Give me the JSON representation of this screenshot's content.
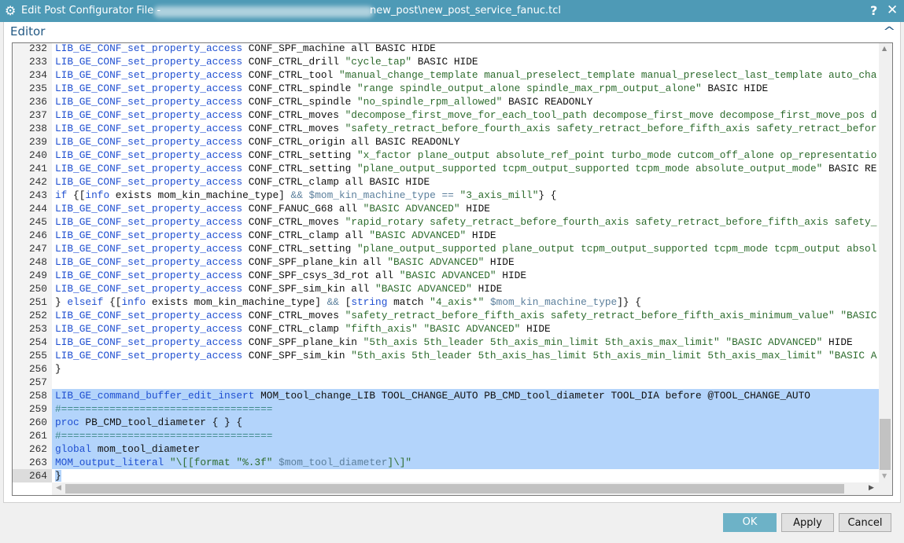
{
  "window": {
    "title": "Edit Post Configurator File -",
    "path": "new_post\\new_post_service_fanuc.tcl",
    "help": "?",
    "close": "✕",
    "icon": "gear-icon"
  },
  "section": {
    "label": "Editor",
    "collapse": "^"
  },
  "editor": {
    "current_line": 264,
    "selection": [
      258,
      264
    ],
    "lines": [
      {
        "n": 232,
        "seg": [
          [
            "c",
            "LIB_GE_CONF_set_property_access"
          ],
          [
            "p",
            " CONF_SPF_machine all BASIC HIDE"
          ]
        ]
      },
      {
        "n": 233,
        "seg": [
          [
            "c",
            "LIB_GE_CONF_set_property_access"
          ],
          [
            "p",
            " CONF_CTRL_drill "
          ],
          [
            "s",
            "\"cycle_tap\""
          ],
          [
            "p",
            " BASIC HIDE"
          ]
        ]
      },
      {
        "n": 234,
        "seg": [
          [
            "c",
            "LIB_GE_CONF_set_property_access"
          ],
          [
            "p",
            " CONF_CTRL_tool "
          ],
          [
            "s",
            "\"manual_change_template manual_preselect_template manual_preselect_last_template auto_cha"
          ]
        ]
      },
      {
        "n": 235,
        "seg": [
          [
            "c",
            "LIB_GE_CONF_set_property_access"
          ],
          [
            "p",
            " CONF_CTRL_spindle "
          ],
          [
            "s",
            "\"range spindle_output_alone spindle_max_rpm_output_alone\""
          ],
          [
            "p",
            " BASIC HIDE"
          ]
        ]
      },
      {
        "n": 236,
        "seg": [
          [
            "c",
            "LIB_GE_CONF_set_property_access"
          ],
          [
            "p",
            " CONF_CTRL_spindle "
          ],
          [
            "s",
            "\"no_spindle_rpm_allowed\""
          ],
          [
            "p",
            " BASIC READONLY"
          ]
        ]
      },
      {
        "n": 237,
        "seg": [
          [
            "c",
            "LIB_GE_CONF_set_property_access"
          ],
          [
            "p",
            " CONF_CTRL_moves "
          ],
          [
            "s",
            "\"decompose_first_move_for_each_tool_path decompose_first_move decompose_first_move_pos d"
          ]
        ]
      },
      {
        "n": 238,
        "seg": [
          [
            "c",
            "LIB_GE_CONF_set_property_access"
          ],
          [
            "p",
            " CONF_CTRL_moves "
          ],
          [
            "s",
            "\"safety_retract_before_fourth_axis safety_retract_before_fifth_axis safety_retract_befor"
          ]
        ]
      },
      {
        "n": 239,
        "seg": [
          [
            "c",
            "LIB_GE_CONF_set_property_access"
          ],
          [
            "p",
            " CONF_CTRL_origin all BASIC READONLY"
          ]
        ]
      },
      {
        "n": 240,
        "seg": [
          [
            "c",
            "LIB_GE_CONF_set_property_access"
          ],
          [
            "p",
            " CONF_CTRL_setting "
          ],
          [
            "s",
            "\"x_factor plane_output absolute_ref_point turbo_mode cutcom_off_alone op_representatio"
          ]
        ]
      },
      {
        "n": 241,
        "seg": [
          [
            "c",
            "LIB_GE_CONF_set_property_access"
          ],
          [
            "p",
            " CONF_CTRL_setting "
          ],
          [
            "s",
            "\"plane_output_supported tcpm_output_supported tcpm_mode absolute_output_mode\""
          ],
          [
            "p",
            " BASIC RE"
          ]
        ]
      },
      {
        "n": 242,
        "seg": [
          [
            "c",
            "LIB_GE_CONF_set_property_access"
          ],
          [
            "p",
            " CONF_CTRL_clamp all BASIC HIDE"
          ]
        ]
      },
      {
        "n": 243,
        "seg": [
          [
            "k",
            "if"
          ],
          [
            "p",
            " {["
          ],
          [
            "k",
            "info"
          ],
          [
            "p",
            " exists mom_kin_machine_type] "
          ],
          [
            "v",
            "&& $mom_kin_machine_type =="
          ],
          [
            "p",
            " "
          ],
          [
            "s",
            "\"3_axis_mill\""
          ],
          [
            "p",
            "} {"
          ]
        ]
      },
      {
        "n": 244,
        "seg": [
          [
            "c",
            "LIB_GE_CONF_set_property_access"
          ],
          [
            "p",
            " CONF_FANUC_G68 all "
          ],
          [
            "s",
            "\"BASIC ADVANCED\""
          ],
          [
            "p",
            " HIDE"
          ]
        ]
      },
      {
        "n": 245,
        "seg": [
          [
            "c",
            "LIB_GE_CONF_set_property_access"
          ],
          [
            "p",
            " CONF_CTRL_moves "
          ],
          [
            "s",
            "\"rapid_rotary safety_retract_before_fourth_axis safety_retract_before_fifth_axis safety_"
          ]
        ]
      },
      {
        "n": 246,
        "seg": [
          [
            "c",
            "LIB_GE_CONF_set_property_access"
          ],
          [
            "p",
            " CONF_CTRL_clamp all "
          ],
          [
            "s",
            "\"BASIC ADVANCED\""
          ],
          [
            "p",
            " HIDE"
          ]
        ]
      },
      {
        "n": 247,
        "seg": [
          [
            "c",
            "LIB_GE_CONF_set_property_access"
          ],
          [
            "p",
            " CONF_CTRL_setting "
          ],
          [
            "s",
            "\"plane_output_supported plane_output tcpm_output_supported tcpm_mode tcpm_output absol"
          ]
        ]
      },
      {
        "n": 248,
        "seg": [
          [
            "c",
            "LIB_GE_CONF_set_property_access"
          ],
          [
            "p",
            " CONF_SPF_plane_kin all "
          ],
          [
            "s",
            "\"BASIC ADVANCED\""
          ],
          [
            "p",
            " HIDE"
          ]
        ]
      },
      {
        "n": 249,
        "seg": [
          [
            "c",
            "LIB_GE_CONF_set_property_access"
          ],
          [
            "p",
            " CONF_SPF_csys_3d_rot all "
          ],
          [
            "s",
            "\"BASIC ADVANCED\""
          ],
          [
            "p",
            " HIDE"
          ]
        ]
      },
      {
        "n": 250,
        "seg": [
          [
            "c",
            "LIB_GE_CONF_set_property_access"
          ],
          [
            "p",
            " CONF_SPF_sim_kin all "
          ],
          [
            "s",
            "\"BASIC ADVANCED\""
          ],
          [
            "p",
            " HIDE"
          ]
        ]
      },
      {
        "n": 251,
        "seg": [
          [
            "p",
            "} "
          ],
          [
            "k",
            "elseif"
          ],
          [
            "p",
            " {["
          ],
          [
            "k",
            "info"
          ],
          [
            "p",
            " exists mom_kin_machine_type] "
          ],
          [
            "v",
            "&&"
          ],
          [
            "p",
            " ["
          ],
          [
            "k",
            "string"
          ],
          [
            "p",
            " match "
          ],
          [
            "s",
            "\"4_axis*\""
          ],
          [
            "p",
            " "
          ],
          [
            "v",
            "$mom_kin_machine_type"
          ],
          [
            "p",
            "]} {"
          ]
        ]
      },
      {
        "n": 252,
        "seg": [
          [
            "c",
            "LIB_GE_CONF_set_property_access"
          ],
          [
            "p",
            " CONF_CTRL_moves "
          ],
          [
            "s",
            "\"safety_retract_before_fifth_axis safety_retract_before_fifth_axis_minimum_value\" \"BASIC"
          ]
        ]
      },
      {
        "n": 253,
        "seg": [
          [
            "c",
            "LIB_GE_CONF_set_property_access"
          ],
          [
            "p",
            " CONF_CTRL_clamp "
          ],
          [
            "s",
            "\"fifth_axis\" \"BASIC ADVANCED\""
          ],
          [
            "p",
            " HIDE"
          ]
        ]
      },
      {
        "n": 254,
        "seg": [
          [
            "c",
            "LIB_GE_CONF_set_property_access"
          ],
          [
            "p",
            " CONF_SPF_plane_kin "
          ],
          [
            "s",
            "\"5th_axis 5th_leader 5th_axis_min_limit 5th_axis_max_limit\" \"BASIC ADVANCED\""
          ],
          [
            "p",
            " HIDE"
          ]
        ]
      },
      {
        "n": 255,
        "seg": [
          [
            "c",
            "LIB_GE_CONF_set_property_access"
          ],
          [
            "p",
            " CONF_SPF_sim_kin "
          ],
          [
            "s",
            "\"5th_axis 5th_leader 5th_axis_has_limit 5th_axis_min_limit 5th_axis_max_limit\" \"BASIC A"
          ]
        ]
      },
      {
        "n": 256,
        "seg": [
          [
            "p",
            "}"
          ]
        ]
      },
      {
        "n": 257,
        "seg": []
      },
      {
        "n": 258,
        "seg": [
          [
            "c",
            "LIB_GE_command_buffer_edit_insert"
          ],
          [
            "p",
            " MOM_tool_change_LIB TOOL_CHANGE_AUTO PB_CMD_tool_diameter TOOL_DIA before @TOOL_CHANGE_AUTO"
          ]
        ]
      },
      {
        "n": 259,
        "seg": [
          [
            "m",
            "#==================================="
          ]
        ]
      },
      {
        "n": 260,
        "seg": [
          [
            "k",
            "proc"
          ],
          [
            "p",
            " PB_CMD_tool_diameter { } {"
          ]
        ]
      },
      {
        "n": 261,
        "seg": [
          [
            "m",
            "#==================================="
          ]
        ]
      },
      {
        "n": 262,
        "seg": [
          [
            "k",
            "global"
          ],
          [
            "p",
            " mom_tool_diameter"
          ]
        ]
      },
      {
        "n": 263,
        "seg": [
          [
            "c",
            "MOM_output_literal"
          ],
          [
            "p",
            " "
          ],
          [
            "s",
            "\"\\[[format \"%.3f\" "
          ],
          [
            "v",
            "$mom_tool_diameter"
          ],
          [
            "s",
            "]\\]\""
          ]
        ]
      },
      {
        "n": 264,
        "seg": [
          [
            "p",
            "}"
          ]
        ]
      }
    ]
  },
  "buttons": {
    "ok": "OK",
    "apply": "Apply",
    "cancel": "Cancel"
  },
  "colors": {
    "titlebar": "#4e9ab6",
    "ok_button": "#6db2c7",
    "selection": "#b3d4fb",
    "command": "#1f4fd1",
    "string": "#2d6b2d"
  }
}
